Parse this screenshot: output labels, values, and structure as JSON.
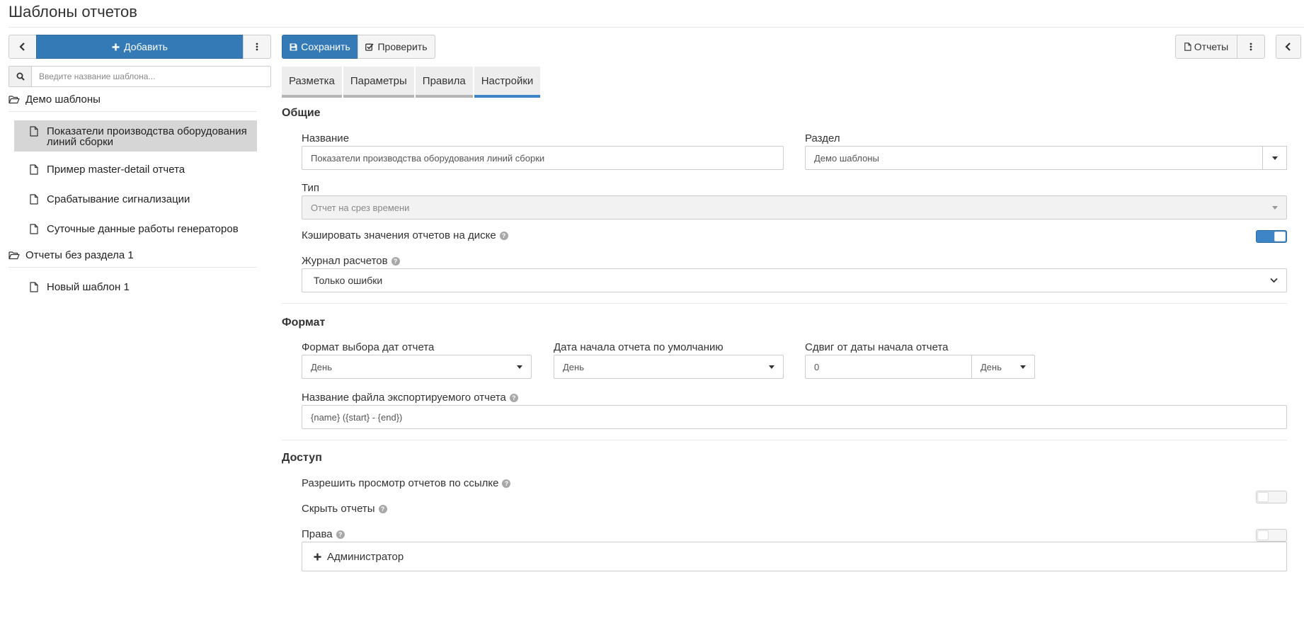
{
  "page": {
    "title": "Шаблоны отчетов"
  },
  "left_toolbar": {
    "add_label": "Добавить"
  },
  "search": {
    "placeholder": "Введите название шаблона..."
  },
  "tree": {
    "folders": [
      {
        "label": "Демо шаблоны",
        "items": [
          {
            "label": "Показатели производства оборудования линий сборки",
            "active": true
          },
          {
            "label": "Пример master-detail отчета"
          },
          {
            "label": "Срабатывание сигнализации"
          },
          {
            "label": "Суточные данные работы генераторов"
          }
        ]
      },
      {
        "label": "Отчеты без раздела 1",
        "items": [
          {
            "label": "Новый шаблон 1"
          }
        ]
      }
    ]
  },
  "main_toolbar": {
    "save_label": "Сохранить",
    "check_label": "Проверить",
    "reports_label": "Отчеты"
  },
  "tabs": [
    {
      "label": "Разметка"
    },
    {
      "label": "Параметры"
    },
    {
      "label": "Правила"
    },
    {
      "label": "Настройки",
      "active": true
    }
  ],
  "general": {
    "title": "Общие",
    "name_label": "Название",
    "name_value": "Показатели производства оборудования линий сборки",
    "section_label": "Раздел",
    "section_value": "Демо шаблоны",
    "type_label": "Тип",
    "type_value": "Отчет на срез времени",
    "cache_label": "Кэшировать значения отчетов на диске",
    "cache_on": true,
    "log_label": "Журнал расчетов",
    "log_value": "Только ошибки"
  },
  "format": {
    "title": "Формат",
    "date_format_label": "Формат выбора дат отчета",
    "date_format_value": "День",
    "start_default_label": "Дата начала отчета по умолчанию",
    "start_default_value": "День",
    "shift_label": "Сдвиг от даты начала отчета",
    "shift_value": "0",
    "shift_unit": "День",
    "filename_label": "Название файла экспортируемого отчета",
    "filename_value": "{name} ({start} - {end})"
  },
  "access": {
    "title": "Доступ",
    "link_view_label": "Разрешить просмотр отчетов по ссылке",
    "link_view_on": false,
    "hide_label": "Скрыть отчеты",
    "hide_on": false,
    "rights_label": "Права",
    "admin_label": "Администратор"
  }
}
